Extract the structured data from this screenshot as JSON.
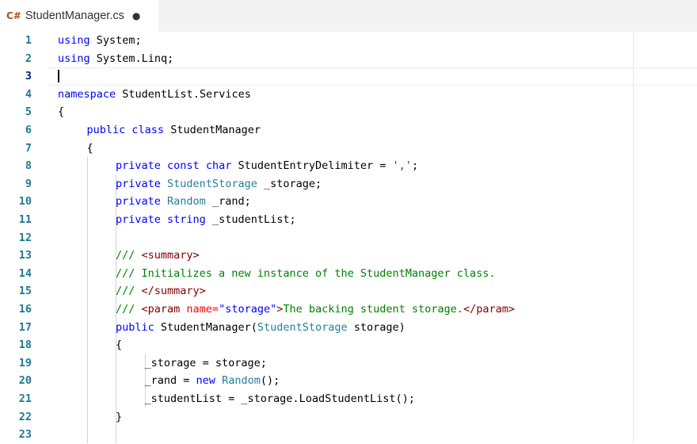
{
  "tab": {
    "icon": "C#",
    "filename": "StudentManager.cs",
    "dirty": "●"
  },
  "lines": [
    "1",
    "2",
    "3",
    "4",
    "5",
    "6",
    "7",
    "8",
    "9",
    "10",
    "11",
    "12",
    "13",
    "14",
    "15",
    "16",
    "17",
    "18",
    "19",
    "20",
    "21",
    "22",
    "23"
  ],
  "code": {
    "l1": {
      "kw": "using",
      "rest": " System;"
    },
    "l2": {
      "kw": "using",
      "rest": " System.Linq;"
    },
    "l4": {
      "kw": "namespace",
      "rest": " StudentList.Services"
    },
    "l5": {
      "text": "{"
    },
    "l6": {
      "kw1": "public",
      "kw2": "class",
      "rest": " StudentManager"
    },
    "l7": {
      "text": "{"
    },
    "l8": {
      "kw1": "private",
      "kw2": "const",
      "kw3": "char",
      "rest": " StudentEntryDelimiter = ",
      "str": "','",
      "end": ";"
    },
    "l9": {
      "kw": "private",
      "ty": "StudentStorage",
      "rest": " _storage;"
    },
    "l10": {
      "kw": "private",
      "ty": "Random",
      "rest": " _rand;"
    },
    "l11": {
      "kw1": "private",
      "kw2": "string",
      "rest": " _studentList;"
    },
    "l13": {
      "cm": "/// ",
      "tag": "<summary>"
    },
    "l14": {
      "cm": "/// Initializes a new instance of the StudentManager class."
    },
    "l15": {
      "cm": "/// ",
      "tag": "</summary>"
    },
    "l16": {
      "cm": "/// ",
      "tag_open": "<param ",
      "attr": "name=",
      "val": "\"storage\"",
      "tag_close": ">",
      "body": "The backing student storage.",
      "end_tag": "</param>"
    },
    "l17": {
      "kw": "public",
      "name": " StudentManager(",
      "ty": "StudentStorage",
      "rest": " storage)"
    },
    "l18": {
      "text": "{"
    },
    "l19": {
      "text": "_storage = storage;"
    },
    "l20": {
      "pre": "_rand = ",
      "kw": "new",
      "ty": "Random",
      "rest": "();"
    },
    "l21": {
      "text": "_studentList = _storage.LoadStudentList();"
    },
    "l22": {
      "text": "}"
    }
  },
  "colors": {
    "keyword": "#0000ff",
    "type": "#267f99",
    "comment": "#008000",
    "string": "#a31515",
    "line_number": "#237893",
    "tab_icon": "#a8541a"
  }
}
